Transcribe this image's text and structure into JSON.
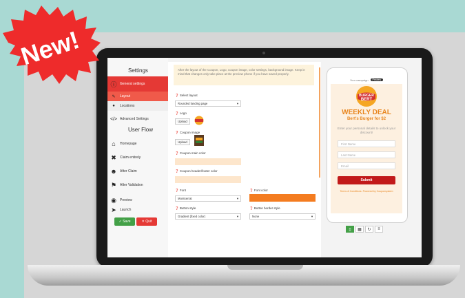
{
  "badge": {
    "text": "New!",
    "color": "#ee2b2b"
  },
  "sidebar": {
    "settings_title": "Settings",
    "items": [
      {
        "label": "General settings",
        "icon": "info-icon"
      },
      {
        "label": "Layout",
        "icon": "pencil-icon"
      },
      {
        "label": "Locations",
        "icon": "pin-icon"
      },
      {
        "label": "Advanced Settings",
        "icon": "code-icon"
      }
    ],
    "user_flow_title": "User Flow",
    "flow_items": [
      {
        "label": "Homepage",
        "icon": "home-icon"
      },
      {
        "label": "Claim entirely",
        "icon": "close-icon"
      },
      {
        "label": "After Claim",
        "icon": "user-icon"
      },
      {
        "label": "After Validation",
        "icon": "flag-icon"
      }
    ],
    "bottom_items": [
      {
        "label": "Preview",
        "icon": "eye-icon"
      },
      {
        "label": "Launch",
        "icon": "send-icon"
      }
    ],
    "save_label": "Save",
    "quit_label": "Quit"
  },
  "form": {
    "info_text": "After the layout of the Coupon, Logo, coupon image, color settings, background image. Keep in mind that changes only take place at the preview phone if you have saved properly.",
    "layout_label": "Select layout",
    "layout_value": "Rounded landing page",
    "logo_label": "Logo",
    "upload_label": "Upload",
    "coupon_image_label": "Coupon image",
    "main_color_label": "Coupon main color",
    "header_footer_label": "Coupon header/footer color",
    "font_label": "Font",
    "font_value": "Montserrat",
    "font_color_label": "Font color",
    "button_style_label": "Button style",
    "button_style_value": "Gradient (fixed color)",
    "button_border_label": "Button border style",
    "button_border_value": "None",
    "colors": {
      "main": "#fde6cc",
      "font": "#f47c20"
    }
  },
  "preview": {
    "top_text": "Your campaign",
    "top_pill": "Preview",
    "logo_line1": "BURGER",
    "logo_line2": "BERT",
    "headline": "WEEKLY DEAL",
    "subhead": "Bert's Burger for $2",
    "instructions": "Enter your personal details to unlock your discount!",
    "fields": [
      "First Name",
      "Last Name",
      "Email"
    ],
    "submit": "Submit",
    "terms": "Terms & Conditions. Powered by Couponsystem"
  }
}
